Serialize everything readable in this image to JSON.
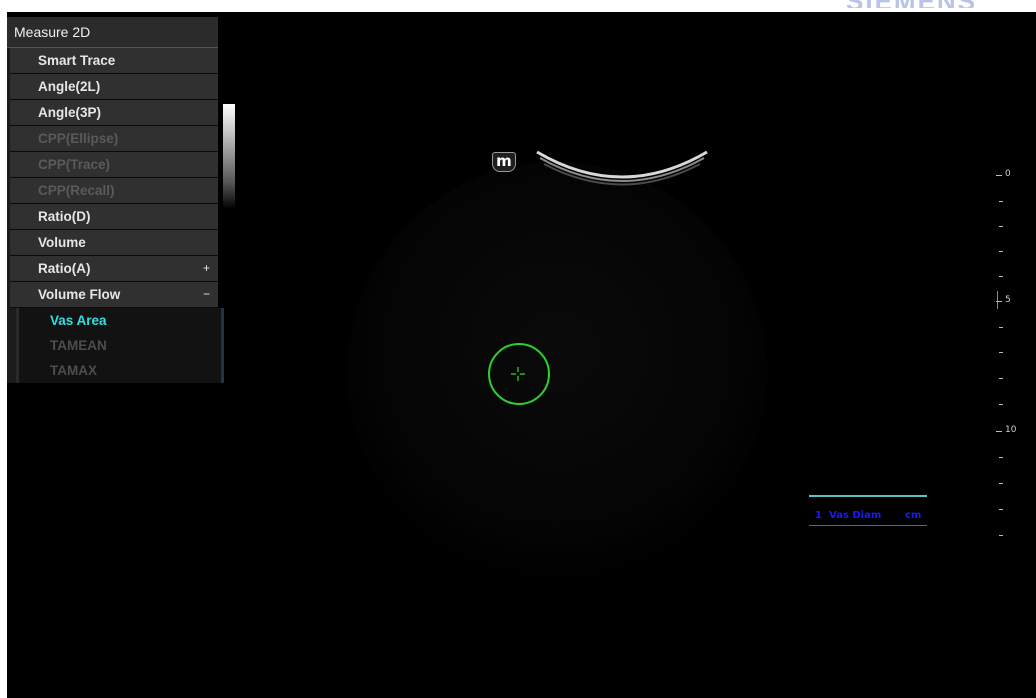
{
  "menu": {
    "title": "Measure 2D",
    "items": [
      {
        "label": "Smart Trace",
        "enabled": true
      },
      {
        "label": "Angle(2L)",
        "enabled": true
      },
      {
        "label": "Angle(3P)",
        "enabled": true
      },
      {
        "label": "CPP(Ellipse)",
        "enabled": false
      },
      {
        "label": "CPP(Trace)",
        "enabled": false
      },
      {
        "label": "CPP(Recall)",
        "enabled": false
      },
      {
        "label": "Ratio(D)",
        "enabled": true
      },
      {
        "label": "Volume",
        "enabled": true
      },
      {
        "label": "Ratio(A)",
        "enabled": true,
        "expander": "+"
      },
      {
        "label": "Volume Flow",
        "enabled": true,
        "expander": "−"
      }
    ],
    "submenu": [
      {
        "label": "Vas Area",
        "active": true
      },
      {
        "label": "TAMEAN",
        "active": false
      },
      {
        "label": "TAMAX",
        "active": false
      }
    ]
  },
  "probe": {
    "marker": "m"
  },
  "depth_scale": {
    "labels": [
      "0",
      "5",
      "10"
    ]
  },
  "result": {
    "index": "1",
    "name": "Vas Diam",
    "unit": "cm"
  },
  "colors": {
    "accent_cyan": "#2fe0e0",
    "cursor_green": "#2ed02e",
    "result_text": "#1a1aff",
    "result_border": "#5cc0c0"
  }
}
